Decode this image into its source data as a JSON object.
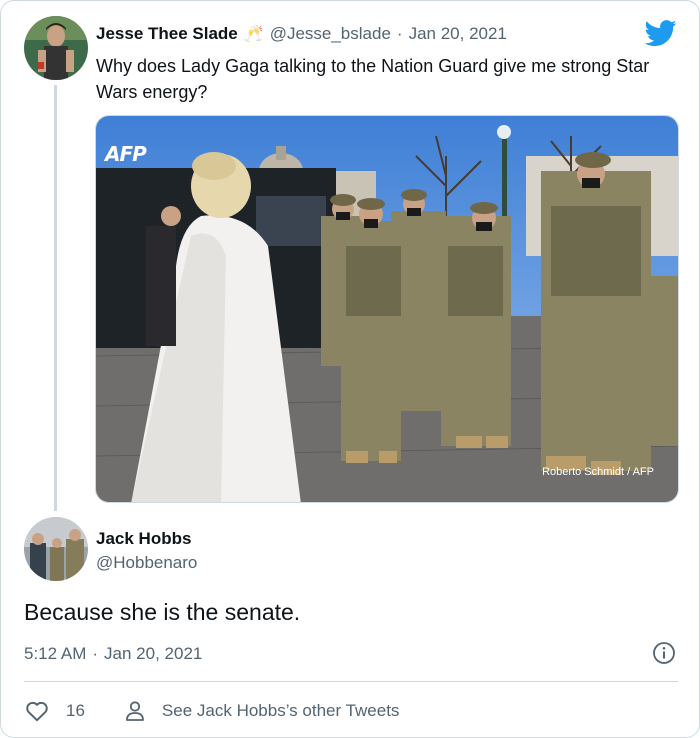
{
  "parent_tweet": {
    "author_name": "Jesse Thee Slade",
    "name_emoji": "🥂",
    "handle": "@Jesse_bslade",
    "separator": "·",
    "date": "Jan 20, 2021",
    "text": "Why does Lady Gaga talking to the Nation Guard give me strong Star Wars energy?",
    "avatar_icon": "profile-photo",
    "photo": {
      "logo": "AFP",
      "credit": "Roberto Schmidt / AFP"
    }
  },
  "brand": {
    "icon": "twitter-bird-icon",
    "color": "#1d9bf0"
  },
  "reply_tweet": {
    "author_name": "Jack Hobbs",
    "handle": "@Hobbenaro",
    "text": "Because she is the senate.",
    "time": "5:12 AM",
    "separator": "·",
    "date": "Jan 20, 2021"
  },
  "actions": {
    "like_count": "16",
    "see_more_label": "See Jack Hobbs’s other Tweets",
    "like_icon": "heart-icon",
    "profile_icon": "person-icon",
    "info_icon": "info-icon"
  },
  "colors": {
    "text_primary": "#0f1419",
    "text_secondary": "#536471",
    "border": "#cfd9de"
  }
}
